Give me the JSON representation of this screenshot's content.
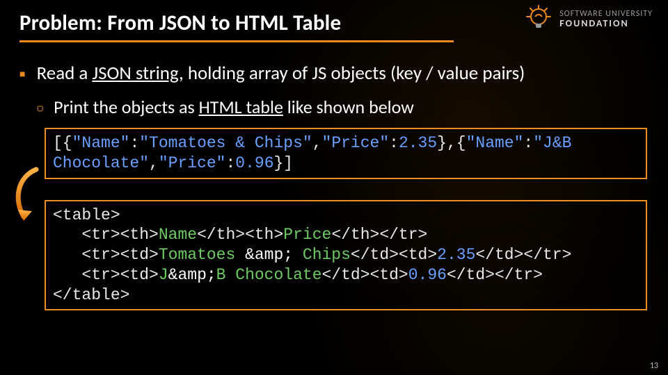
{
  "title": "Problem: From JSON to HTML Table",
  "logo": {
    "line1": "SOFTWARE UNIVERSITY",
    "line2": "FOUNDATION"
  },
  "bullets": {
    "b1_pre": "Read a ",
    "b1_u": "JSON string",
    "b1_post": ", holding array of JS objects (key / value pairs)",
    "b1a_pre": "Print the objects as ",
    "b1a_u": "HTML table",
    "b1a_post": " like shown below"
  },
  "json_example": {
    "l1": "[{\"Name\":\"Tomatoes & Chips\",\"Price\":2.35},{\"Name\":\"J&B",
    "l2": "Chocolate\",\"Price\":0.96}]"
  },
  "html_example": {
    "l1": "<table>",
    "l2": "   <tr><th>Name</th><th>Price</th></tr>",
    "l3": "   <tr><td>Tomatoes &amp; Chips</td><td>2.35</td></tr>",
    "l4": "   <tr><td>J&amp;B Chocolate</td><td>0.96</td></tr>",
    "l5": "</table>"
  },
  "page_number": "13"
}
